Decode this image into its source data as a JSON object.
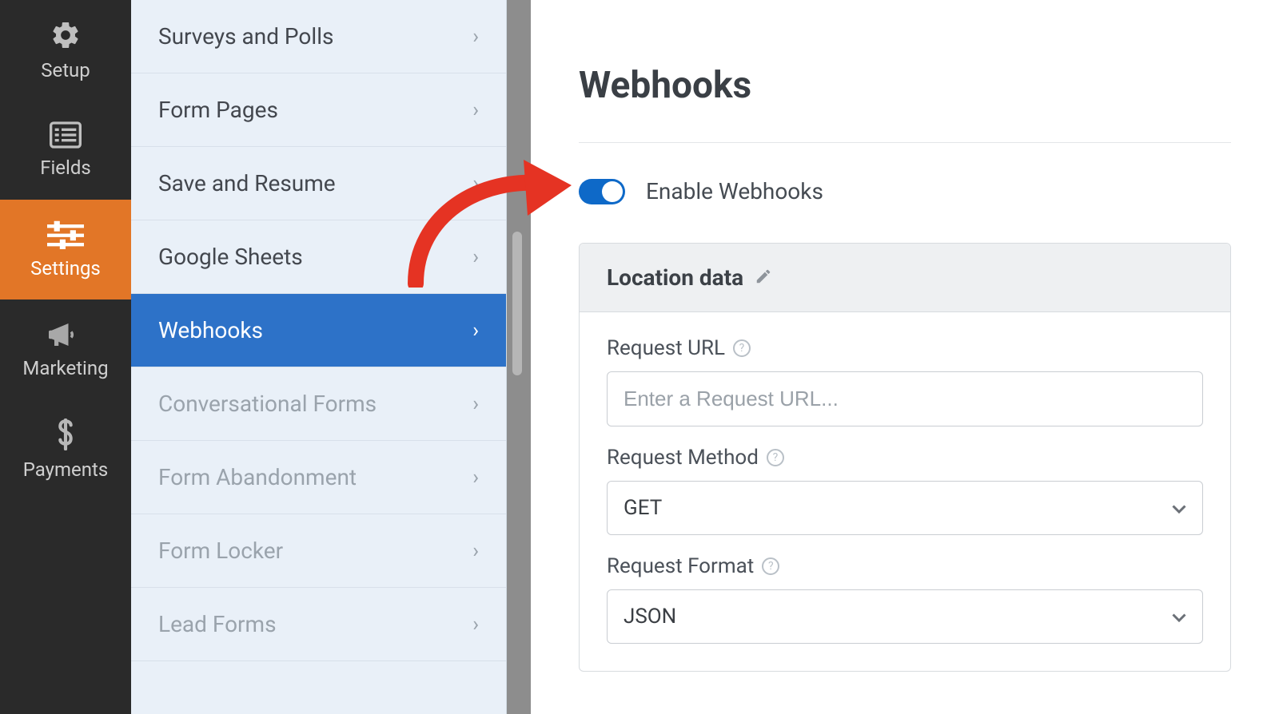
{
  "iconRail": [
    {
      "id": "setup",
      "label": "Setup",
      "active": false
    },
    {
      "id": "fields",
      "label": "Fields",
      "active": false
    },
    {
      "id": "settings",
      "label": "Settings",
      "active": true
    },
    {
      "id": "marketing",
      "label": "Marketing",
      "active": false
    },
    {
      "id": "payments",
      "label": "Payments",
      "active": false
    }
  ],
  "settingsSidebar": [
    {
      "label": "Surveys and Polls",
      "active": false,
      "muted": false
    },
    {
      "label": "Form Pages",
      "active": false,
      "muted": false
    },
    {
      "label": "Save and Resume",
      "active": false,
      "muted": false
    },
    {
      "label": "Google Sheets",
      "active": false,
      "muted": false
    },
    {
      "label": "Webhooks",
      "active": true,
      "muted": false
    },
    {
      "label": "Conversational Forms",
      "active": false,
      "muted": true
    },
    {
      "label": "Form Abandonment",
      "active": false,
      "muted": true
    },
    {
      "label": "Form Locker",
      "active": false,
      "muted": true
    },
    {
      "label": "Lead Forms",
      "active": false,
      "muted": true
    }
  ],
  "panel": {
    "title": "Webhooks",
    "toggleLabel": "Enable Webhooks",
    "toggleOn": true,
    "settingTitle": "Location data",
    "fields": {
      "requestUrl": {
        "label": "Request URL",
        "placeholder": "Enter a Request URL...",
        "value": ""
      },
      "requestMethod": {
        "label": "Request Method",
        "value": "GET"
      },
      "requestFormat": {
        "label": "Request Format",
        "value": "JSON"
      }
    }
  }
}
